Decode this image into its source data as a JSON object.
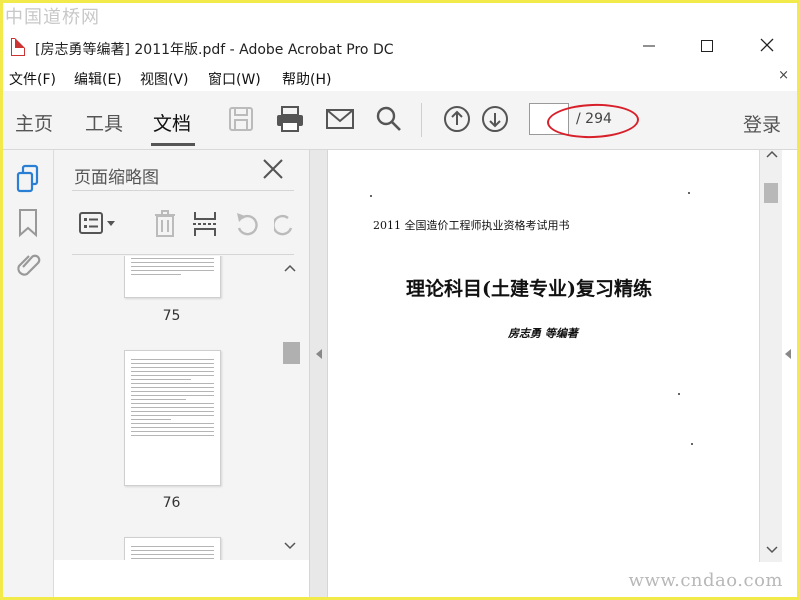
{
  "watermarks": {
    "top": "中国道桥网",
    "bottom": "www.cndao.com"
  },
  "window": {
    "title": "[房志勇等编著] 2011年版.pdf - Adobe Acrobat Pro DC",
    "icon": "pdf-file-icon",
    "controls": {
      "minimize": "—",
      "maximize": "☐",
      "close": "✕"
    }
  },
  "menu": {
    "items": [
      "文件(F)",
      "编辑(E)",
      "视图(V)",
      "窗口(W)",
      "帮助(H)"
    ],
    "close": "×"
  },
  "toolbar": {
    "tabs": [
      "主页",
      "工具",
      "文档"
    ],
    "active_tab": "文档",
    "icons": [
      "save-icon",
      "print-icon",
      "email-icon",
      "search-icon",
      "page-up-icon",
      "page-down-icon"
    ],
    "page_input": "",
    "page_total": "/ 294",
    "login": "登录"
  },
  "left_rail": {
    "icons": [
      "page-thumbnails-icon",
      "bookmark-icon",
      "attachment-icon"
    ]
  },
  "thumbnail_panel": {
    "title": "页面缩略图",
    "close": "✕",
    "tools": [
      "options-menu-icon",
      "delete-page-icon",
      "insert-page-icon",
      "rotate-left-icon",
      "rotate-right-icon"
    ],
    "pages": [
      "75",
      "76",
      ""
    ]
  },
  "document": {
    "series": "2011 全国造价工程师执业资格考试用书",
    "title": "理论科目(土建专业)复习精练",
    "author": "房志勇  等编著"
  },
  "colors": {
    "accent_blue": "#2a7fd4",
    "annotation_red": "#d8202a",
    "frame_yellow": "#f2e94a"
  }
}
